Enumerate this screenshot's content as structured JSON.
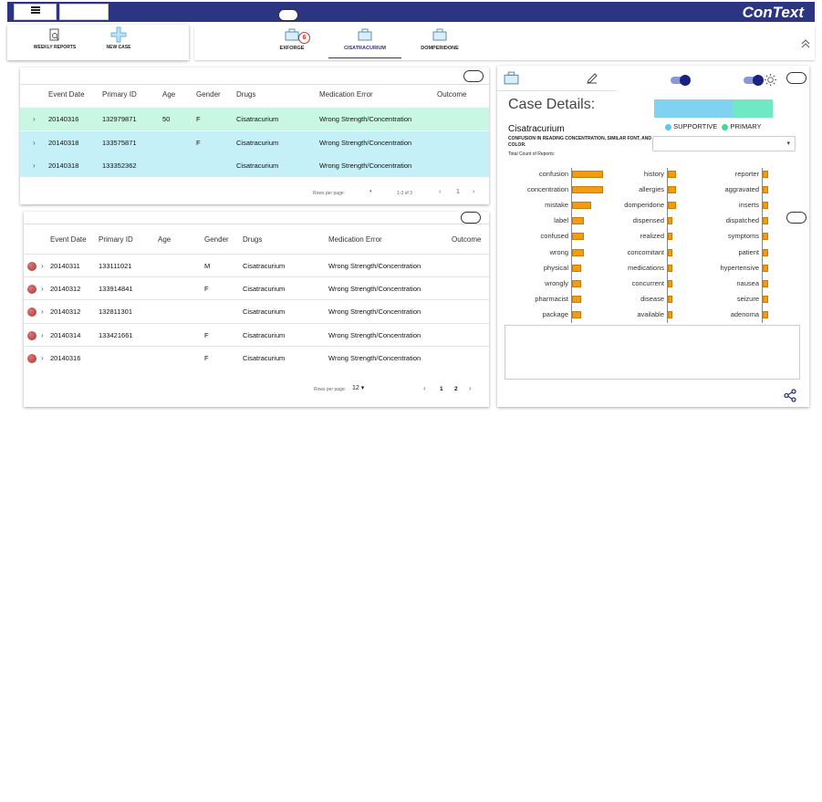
{
  "app": {
    "title": "ConText"
  },
  "toolbar": {
    "weekly_reports": "WEEKLY REPORTS",
    "new_case": "NEW CASE"
  },
  "tabs": [
    {
      "label": "EXFORGE",
      "badge": "6"
    },
    {
      "label": "CISATRACURIUM",
      "active": true
    },
    {
      "label": "DOMPERIDONE"
    }
  ],
  "table_headers": [
    "Event Date",
    "Primary ID",
    "Age",
    "Gender",
    "Drugs",
    "Medication Error",
    "Outcome"
  ],
  "table1": {
    "rows": [
      {
        "date": "20140316",
        "id": "132979871",
        "age": "50",
        "gender": "F",
        "drug": "Cisatracurium",
        "error": "Wrong Strength/Concentration",
        "color": "#c9f7e3"
      },
      {
        "date": "20140318",
        "id": "133575871",
        "age": "",
        "gender": "F",
        "drug": "Cisatracurium",
        "error": "Wrong Strength/Concentration",
        "color": "#c6f0f7"
      },
      {
        "date": "20140318",
        "id": "133352362",
        "age": "",
        "gender": "",
        "drug": "Cisatracurium",
        "error": "Wrong Strength/Concentration",
        "color": "#c6f0f7"
      }
    ],
    "rows_per_page": "Rows per page:",
    "range": "1-3 of 3"
  },
  "table2": {
    "rows": [
      {
        "date": "20140311",
        "id": "133111021",
        "age": "",
        "gender": "M",
        "drug": "Cisatracurium",
        "error": "Wrong Strength/Concentration"
      },
      {
        "date": "20140312",
        "id": "133914841",
        "age": "",
        "gender": "F",
        "drug": "Cisatracurium",
        "error": "Wrong Strength/Concentration"
      },
      {
        "date": "20140312",
        "id": "132811301",
        "age": "",
        "gender": "",
        "drug": "Cisatracurium",
        "error": "Wrong Strength/Concentration"
      },
      {
        "date": "20140314",
        "id": "133421661",
        "age": "",
        "gender": "F",
        "drug": "Cisatracurium",
        "error": "Wrong Strength/Concentration"
      },
      {
        "date": "20140316",
        "id": "",
        "age": "",
        "gender": "F",
        "drug": "Cisatracurium",
        "error": "Wrong Strength/Concentration"
      }
    ],
    "rows_per_page": "Rows per page:",
    "rows_per_page_value": "12",
    "pages": [
      "1",
      "2"
    ]
  },
  "case_details": {
    "heading": "Case Details:",
    "drug": "Cisatracurium",
    "description": "CONFUSION IN READING CONCENTRATION, SIMILAR FONT, AND COLOR.",
    "count_label": "Total Count of Reports:",
    "legend": [
      {
        "label": "SUPPORTIVE",
        "color": "#5bc8ea"
      },
      {
        "label": "PRIMARY",
        "color": "#3ddc97"
      }
    ],
    "proportion": {
      "supportive": 0.66,
      "primary": 0.34
    },
    "select_value": ""
  },
  "word_columns": [
    [
      {
        "w": "confusion",
        "v": 1.0
      },
      {
        "w": "concentration",
        "v": 1.0
      },
      {
        "w": "mistake",
        "v": 0.62
      },
      {
        "w": "label",
        "v": 0.38
      },
      {
        "w": "confused",
        "v": 0.38
      },
      {
        "w": "wrong",
        "v": 0.38
      },
      {
        "w": "physical",
        "v": 0.28
      },
      {
        "w": "wrongly",
        "v": 0.28
      },
      {
        "w": "pharmacist",
        "v": 0.28
      },
      {
        "w": "package",
        "v": 0.28
      }
    ],
    [
      {
        "w": "history",
        "v": 0.85
      },
      {
        "w": "allergies",
        "v": 0.85
      },
      {
        "w": "domperidone",
        "v": 0.85
      },
      {
        "w": "dispensed",
        "v": 0.45
      },
      {
        "w": "realized",
        "v": 0.45
      },
      {
        "w": "concomitant",
        "v": 0.45
      },
      {
        "w": "medications",
        "v": 0.45
      },
      {
        "w": "concurrent",
        "v": 0.45
      },
      {
        "w": "disease",
        "v": 0.45
      },
      {
        "w": "available",
        "v": 0.45
      }
    ],
    [
      {
        "w": "reporter",
        "v": 1.0
      },
      {
        "w": "aggravated",
        "v": 1.0
      },
      {
        "w": "inserts",
        "v": 1.0
      },
      {
        "w": "dispatched",
        "v": 1.0
      },
      {
        "w": "symptoms",
        "v": 1.0
      },
      {
        "w": "patient",
        "v": 1.0
      },
      {
        "w": "hypertensive",
        "v": 1.0
      },
      {
        "w": "nausea",
        "v": 1.0
      },
      {
        "w": "seizure",
        "v": 1.0
      },
      {
        "w": "adenoma",
        "v": 1.0
      }
    ]
  ],
  "icons": [
    "menu-icon",
    "search-document-icon",
    "plus-icon",
    "briefcase-icon",
    "pencil-icon",
    "gear-icon",
    "share-icon",
    "chevron-up-icon",
    "chevron-right-icon",
    "caret-down-icon"
  ]
}
